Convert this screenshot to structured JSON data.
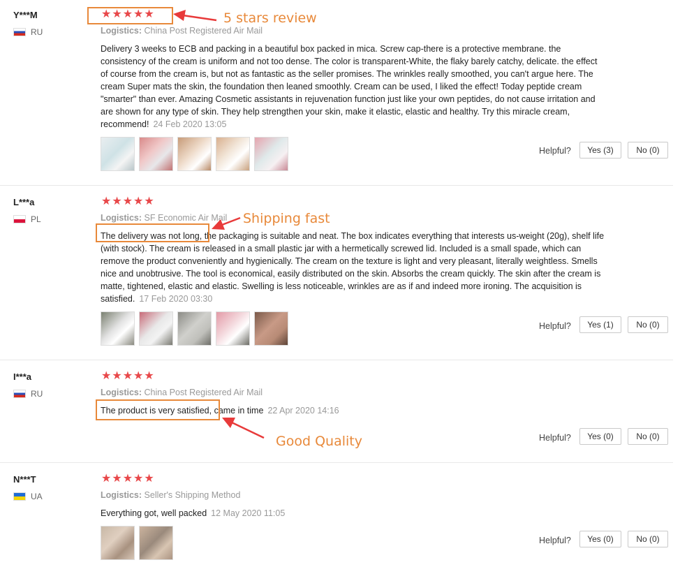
{
  "reviews": [
    {
      "user": "Y***M",
      "country": "RU",
      "stars": "★★★★★",
      "logistics_label": "Logistics:",
      "logistics": "China Post Registered Air Mail",
      "text": "Delivery 3 weeks to ECB and packing in a beautiful box packed in mica. Screw cap-there is a protective membrane. the consistency of the cream is uniform and not too dense. The color is transparent-White, the flaky barely catchy, delicate. the effect of course from the cream is, but not as fantastic as the seller promises. The wrinkles really smoothed, you can't argue here. The cream Super mats the skin, the foundation then leaned smoothly. Cream can be used, I liked the effect! Today peptide cream \"smarter\" than ever. Amazing Cosmetic assistants in rejuvenation function just like your own peptides, do not cause irritation and are shown for any type of skin. They help strengthen your skin, make it elastic, elastic and healthy. Try this miracle cream, recommend!",
      "date": "24 Feb 2020 13:05",
      "helpful": "Helpful?",
      "yes": "Yes (3)",
      "no": "No (0)"
    },
    {
      "user": "L***a",
      "country": "PL",
      "stars": "★★★★★",
      "logistics_label": "Logistics:",
      "logistics": "SF Economic Air Mail",
      "text": "The delivery was not long, the packaging is suitable and neat. The box indicates everything that interests us-weight (20g), shelf life (with stock). The cream is released in a small plastic jar with a hermetically screwed lid. Included is a small spade, which can remove the product conveniently and hygienically. The cream on the texture is light and very pleasant, literally weightless. Smells nice and unobtrusive. The tool is economical, easily distributed on the skin. Absorbs the cream quickly. The skin after the cream is matte, tightened, elastic and elastic. Swelling is less noticeable, wrinkles are as if and indeed more ironing. The acquisition is satisfied.",
      "date": "17 Feb 2020 03:30",
      "helpful": "Helpful?",
      "yes": "Yes (1)",
      "no": "No (0)"
    },
    {
      "user": "I***a",
      "country": "RU",
      "stars": "★★★★★",
      "logistics_label": "Logistics:",
      "logistics": "China Post Registered Air Mail",
      "text": "The product is very satisfied, came in time",
      "date": "22 Apr 2020 14:16",
      "helpful": "Helpful?",
      "yes": "Yes (0)",
      "no": "No (0)"
    },
    {
      "user": "N***T",
      "country": "UA",
      "stars": "★★★★★",
      "logistics_label": "Logistics:",
      "logistics": "Seller's Shipping Method",
      "text": "Everything got, well packed",
      "date": "12 May 2020 11:05",
      "helpful": "Helpful?",
      "yes": "Yes (0)",
      "no": "No (0)"
    }
  ],
  "annotations": {
    "five_stars": "5 stars review",
    "shipping_fast": "Shipping fast",
    "good_quality": "Good Quality"
  },
  "colors": {
    "star": "#e8484a",
    "annotation": "#e8893a"
  }
}
